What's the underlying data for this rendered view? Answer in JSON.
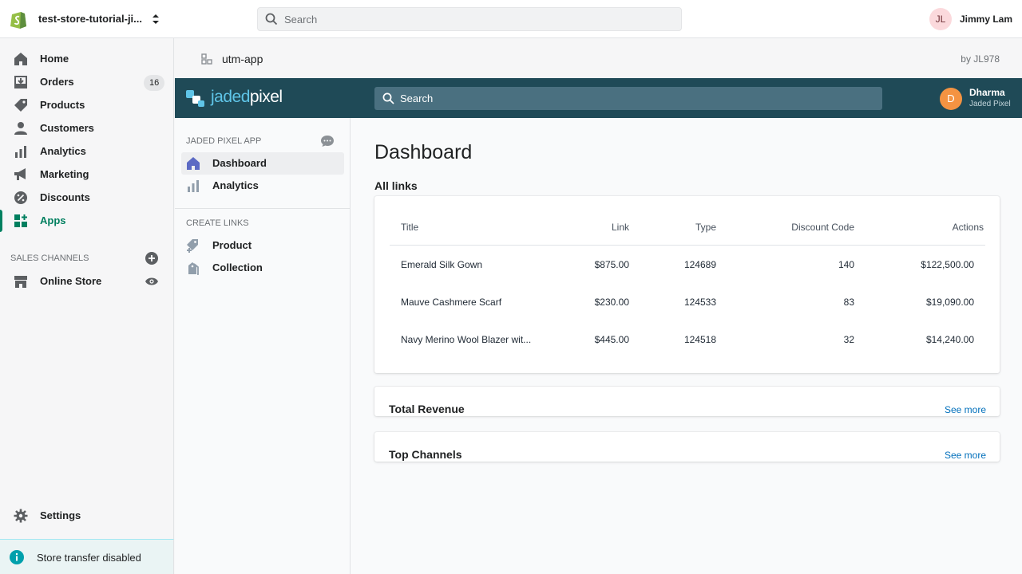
{
  "topbar": {
    "store_name": "test-store-tutorial-ji...",
    "search_placeholder": "Search",
    "user_initials": "JL",
    "user_name": "Jimmy Lam"
  },
  "admin_nav": {
    "items": [
      {
        "label": "Home",
        "icon": "home-icon"
      },
      {
        "label": "Orders",
        "icon": "orders-icon",
        "badge": "16"
      },
      {
        "label": "Products",
        "icon": "tag-icon"
      },
      {
        "label": "Customers",
        "icon": "person-icon"
      },
      {
        "label": "Analytics",
        "icon": "bar-chart-icon"
      },
      {
        "label": "Marketing",
        "icon": "megaphone-icon"
      },
      {
        "label": "Discounts",
        "icon": "discount-icon"
      },
      {
        "label": "Apps",
        "icon": "apps-icon",
        "active": true
      }
    ],
    "sales_channels_title": "SALES CHANNELS",
    "online_store_label": "Online Store",
    "settings_label": "Settings",
    "transfer_notice": "Store transfer disabled"
  },
  "app_header": {
    "app_name": "utm-app",
    "by_label": "by JL978"
  },
  "embedded": {
    "brand_part1": "jaded",
    "brand_part2": "pixel",
    "search_placeholder": "Search",
    "user_initial": "D",
    "user_name": "Dharma",
    "user_org": "Jaded Pixel",
    "nav": {
      "app_section_title": "JADED PIXEL APP",
      "dashboard_label": "Dashboard",
      "analytics_label": "Analytics",
      "create_section_title": "CREATE LINKS",
      "product_label": "Product",
      "collection_label": "Collection"
    },
    "page_title": "Dashboard",
    "links_heading": "All links",
    "table": {
      "columns": [
        "Title",
        "Link",
        "Type",
        "Discount Code",
        "Actions"
      ],
      "rows": [
        [
          "Emerald Silk Gown",
          "$875.00",
          "124689",
          "140",
          "$122,500.00"
        ],
        [
          "Mauve Cashmere Scarf",
          "$230.00",
          "124533",
          "83",
          "$19,090.00"
        ],
        [
          "Navy Merino Wool Blazer wit...",
          "$445.00",
          "124518",
          "32",
          "$14,240.00"
        ]
      ]
    },
    "revenue_card": {
      "title": "Total Revenue",
      "link": "See more"
    },
    "channels_card": {
      "title": "Top Channels",
      "link": "See more"
    }
  },
  "colors": {
    "accent_green": "#008060",
    "brand_bar": "#1f4a57",
    "link_blue": "#006fbb"
  }
}
